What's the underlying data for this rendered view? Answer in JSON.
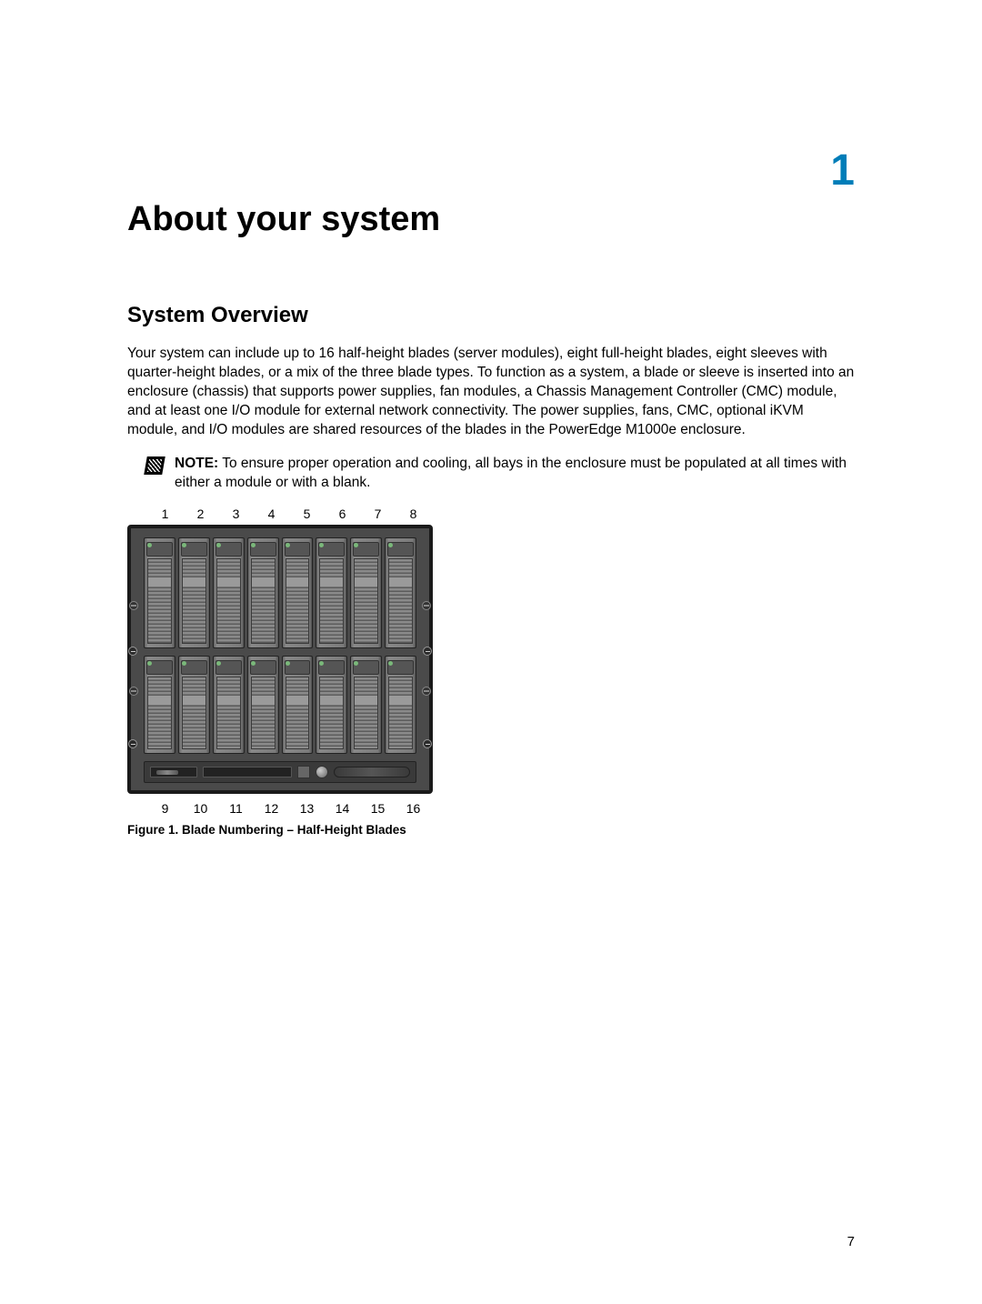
{
  "chapter": {
    "number": "1",
    "title": "About your system"
  },
  "section": {
    "title": "System Overview"
  },
  "paragraphs": {
    "overview": "Your system can include up to 16 half-height blades (server modules), eight full-height blades, eight sleeves with quarter-height blades, or a mix of the three blade types. To function as a system, a blade or sleeve is inserted into an enclosure (chassis) that supports power supplies, fan modules, a Chassis Management Controller (CMC) module, and at least one I/O module for external network connectivity. The power supplies, fans, CMC, optional iKVM module, and I/O modules are shared resources of the blades in the PowerEdge M1000e enclosure."
  },
  "note": {
    "label": "NOTE:",
    "text": " To ensure proper operation and cooling, all bays in the enclosure must be populated at all times with either a module or with a blank."
  },
  "figure": {
    "top_numbers": [
      "1",
      "2",
      "3",
      "4",
      "5",
      "6",
      "7",
      "8"
    ],
    "bottom_numbers": [
      "9",
      "10",
      "11",
      "12",
      "13",
      "14",
      "15",
      "16"
    ],
    "caption": "Figure 1. Blade Numbering – Half-Height Blades"
  },
  "page_number": "7"
}
